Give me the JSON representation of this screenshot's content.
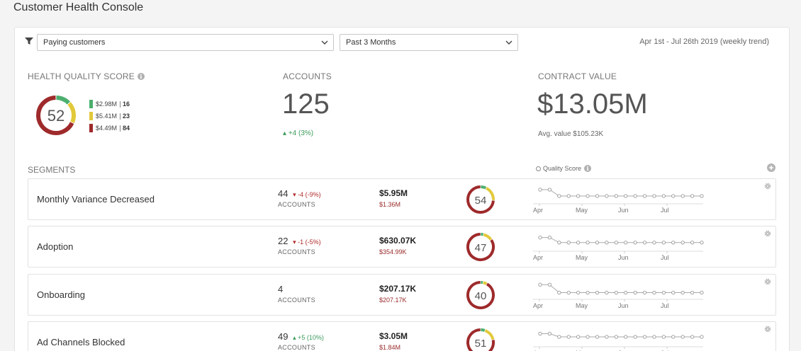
{
  "app_title": "Customer Health Console",
  "filters": {
    "segment_select": "Paying customers",
    "period_select": "Past 3 Months",
    "date_range": "Apr 1st - Jul 26th 2019 (weekly trend)",
    "filter_icon": "filter-icon",
    "chevron_icon": "chevron-down-icon"
  },
  "health_quality": {
    "label": "HEALTH QUALITY SCORE",
    "score": "52",
    "score_value": 52,
    "legend": [
      {
        "amount": "$2.98M",
        "count": "16",
        "color": "#4caf6e"
      },
      {
        "amount": "$5.41M",
        "count": "23",
        "color": "#e2c93a"
      },
      {
        "amount": "$4.49M",
        "count": "84",
        "color": "#9e2a2b"
      }
    ]
  },
  "accounts": {
    "label": "ACCOUNTS",
    "value": "125",
    "delta": "+4 (3%)"
  },
  "contract_value": {
    "label": "CONTRACT VALUE",
    "value": "$13.05M",
    "avg": "Avg. value $105.23K"
  },
  "segments": {
    "title": "SEGMENTS",
    "quality_score_legend": "Quality Score",
    "months": [
      "Apr",
      "May",
      "Jun",
      "Jul"
    ],
    "rows": [
      {
        "name": "Monthly Variance Decreased",
        "accounts": "44",
        "delta": "-4 (-9%)",
        "delta_dir": "down",
        "accounts_label": "ACCOUNTS",
        "value": "$5.95M",
        "sub_value": "$1.36M",
        "score": "54",
        "score_value": 54,
        "trend": [
          57,
          57,
          54,
          54,
          54,
          54,
          54,
          54,
          54,
          54,
          54,
          54,
          54,
          54,
          54,
          54,
          54,
          54
        ]
      },
      {
        "name": "Adoption",
        "accounts": "22",
        "delta": "-1 (-5%)",
        "delta_dir": "down",
        "accounts_label": "ACCOUNTS",
        "value": "$630.07K",
        "sub_value": "$354.99K",
        "score": "47",
        "score_value": 47,
        "trend": [
          49,
          49,
          47,
          47,
          47,
          47,
          47,
          47,
          47,
          47,
          47,
          47,
          47,
          47,
          47,
          47,
          47,
          47
        ]
      },
      {
        "name": "Onboarding",
        "accounts": "4",
        "delta": "",
        "delta_dir": "none",
        "accounts_label": "ACCOUNTS",
        "value": "$207.17K",
        "sub_value": "$207.17K",
        "score": "40",
        "score_value": 40,
        "trend": [
          45,
          45,
          40,
          40,
          40,
          40,
          40,
          40,
          40,
          40,
          40,
          40,
          40,
          40,
          40,
          40,
          40,
          40
        ]
      },
      {
        "name": "Ad Channels Blocked",
        "accounts": "49",
        "delta": "+5 (10%)",
        "delta_dir": "up",
        "accounts_label": "ACCOUNTS",
        "value": "$3.05M",
        "sub_value": "$1.84M",
        "score": "51",
        "score_value": 51,
        "trend": [
          52,
          52,
          51,
          51,
          51,
          51,
          51,
          51,
          51,
          51,
          51,
          51,
          51,
          51,
          51,
          51,
          51,
          51
        ]
      }
    ]
  },
  "colors": {
    "green": "#4caf6e",
    "yellow": "#e2c93a",
    "red": "#9e2a2b",
    "track": "#e5e5e5"
  }
}
